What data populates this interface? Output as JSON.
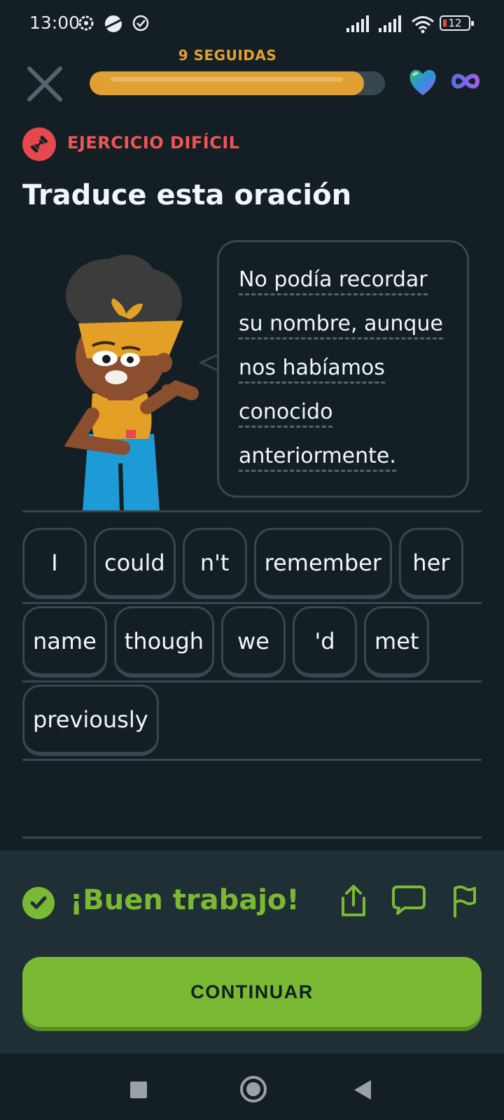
{
  "status_bar": {
    "time": "13:00",
    "battery": "12"
  },
  "header": {
    "streak_label": "9 SEGUIDAS",
    "progress": 0.93
  },
  "exercise": {
    "hard_label": "EJERCICIO DIFÍCIL",
    "title": "Traduce esta oración",
    "sentence_lines": [
      "No podía recordar",
      "su nombre, aunque",
      "nos habíamos",
      "conocido",
      "anteriormente."
    ]
  },
  "answer": {
    "rows": [
      [
        "I",
        "could",
        "n't",
        "remember",
        "her"
      ],
      [
        "name",
        "though",
        "we",
        "'d",
        "met"
      ],
      [
        "previously"
      ]
    ]
  },
  "feedback": {
    "title": "¡Buen trabajo!",
    "continue_label": "CONTINUAR"
  },
  "colors": {
    "background": "#131f24",
    "accent_green": "#79b933",
    "streak_orange": "#e0a032",
    "hard_red": "#e5484d"
  },
  "icons": [
    "close-icon",
    "heart-icon",
    "infinity-icon",
    "dumbbell-icon",
    "check-icon",
    "share-icon",
    "comment-icon",
    "flag-icon"
  ]
}
